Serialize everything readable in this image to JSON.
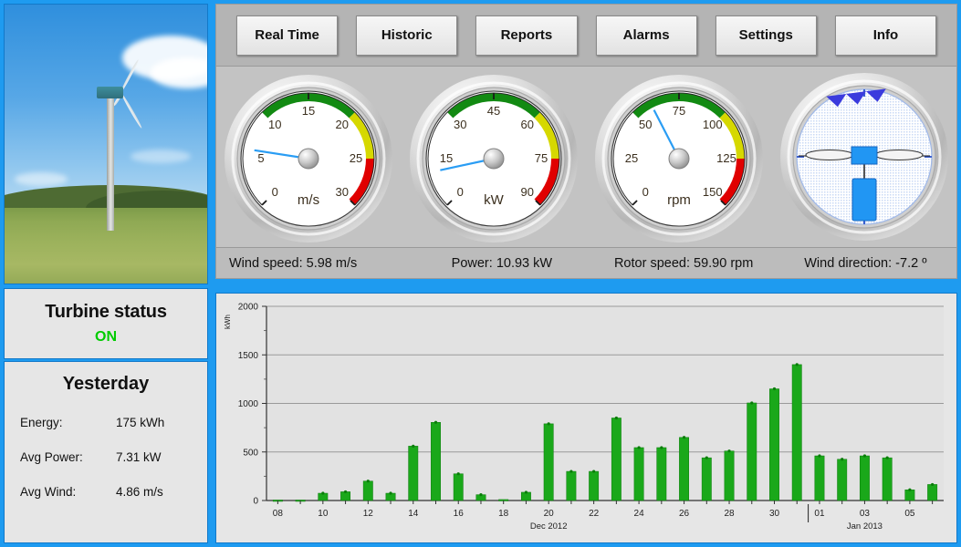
{
  "toolbar": {
    "buttons": [
      {
        "label": "Real Time",
        "name": "tab-real-time"
      },
      {
        "label": "Historic",
        "name": "tab-historic"
      },
      {
        "label": "Reports",
        "name": "tab-reports"
      },
      {
        "label": "Alarms",
        "name": "tab-alarms"
      },
      {
        "label": "Settings",
        "name": "tab-settings"
      },
      {
        "label": "Info",
        "name": "tab-info"
      }
    ]
  },
  "gauges": [
    {
      "id": "wind-speed",
      "unit": "m/s",
      "value": 5.98,
      "min": 0,
      "max": 30,
      "tick_labels": [
        "0",
        "5",
        "10",
        "15",
        "20",
        "25",
        "30"
      ],
      "green_from": 10,
      "green_to": 20,
      "yellow_from": 20,
      "yellow_to": 25,
      "red_from": 25,
      "red_to": 30
    },
    {
      "id": "power",
      "unit": "kW",
      "value": 10.93,
      "min": 0,
      "max": 90,
      "tick_labels": [
        "0",
        "15",
        "30",
        "45",
        "60",
        "75",
        "90"
      ],
      "green_from": 30,
      "green_to": 60,
      "yellow_from": 60,
      "yellow_to": 75,
      "red_from": 75,
      "red_to": 90
    },
    {
      "id": "rotor-speed",
      "unit": "rpm",
      "value": 59.9,
      "min": 0,
      "max": 150,
      "tick_labels": [
        "0",
        "25",
        "50",
        "75",
        "100",
        "125",
        "150"
      ],
      "green_from": 50,
      "green_to": 100,
      "yellow_from": 100,
      "yellow_to": 125,
      "red_from": 125,
      "red_to": 150
    }
  ],
  "wind_direction_widget": {
    "id": "wind-direction",
    "value_deg": -7.2,
    "arrow_count": 3
  },
  "readouts": [
    {
      "name": "readout-wind-speed",
      "text": "Wind speed: 5.98 m/s"
    },
    {
      "name": "readout-power",
      "text": "Power:  10.93 kW"
    },
    {
      "name": "readout-rotor-speed",
      "text": "Rotor speed: 59.90 rpm"
    },
    {
      "name": "readout-wind-direction",
      "text": "Wind direction:  -7.2 º"
    }
  ],
  "status": {
    "title": "Turbine status",
    "value": "ON",
    "value_color": "#00cc00"
  },
  "yesterday": {
    "title": "Yesterday",
    "rows": [
      {
        "label": "Energy:",
        "value": "175 kWh"
      },
      {
        "label": "Avg Power:",
        "value": "7.31 kW"
      },
      {
        "label": "Avg Wind:",
        "value": "4.86 m/s"
      }
    ]
  },
  "colors": {
    "frame_blue": "#1e9bf0",
    "bar_green": "#1aa81a",
    "gauge_green": "#128a12",
    "gauge_yellow": "#d6d800",
    "gauge_red": "#e00000",
    "needle_blue": "#2a9df4",
    "panel_gray": "#e6e6e6",
    "toolbar_gray": "#b4b4b4"
  },
  "chart_data": {
    "type": "bar",
    "title": "",
    "xlabel": "",
    "ylabel": "kWh",
    "ylim": [
      0,
      2000
    ],
    "yticks": [
      0,
      500,
      1000,
      1500,
      2000
    ],
    "grid": true,
    "legend": false,
    "month_labels": [
      {
        "label": "Dec 2012",
        "at": "20"
      },
      {
        "label": "Jan 2013",
        "at": "03"
      }
    ],
    "tick_labels": [
      "08",
      "10",
      "12",
      "14",
      "16",
      "18",
      "20",
      "22",
      "24",
      "26",
      "28",
      "30",
      "01",
      "03",
      "05"
    ],
    "categories": [
      "08",
      "09",
      "10",
      "11",
      "12",
      "13",
      "14",
      "15",
      "16",
      "17",
      "18",
      "19",
      "20",
      "21",
      "22",
      "23",
      "24",
      "25",
      "26",
      "27",
      "28",
      "29",
      "30",
      "31",
      "01",
      "02",
      "03",
      "04",
      "05",
      "06"
    ],
    "values": [
      5,
      5,
      75,
      90,
      200,
      75,
      560,
      805,
      275,
      60,
      10,
      85,
      790,
      300,
      300,
      850,
      545,
      545,
      650,
      440,
      510,
      1005,
      1150,
      1400,
      460,
      425,
      460,
      440,
      110,
      165
    ]
  }
}
